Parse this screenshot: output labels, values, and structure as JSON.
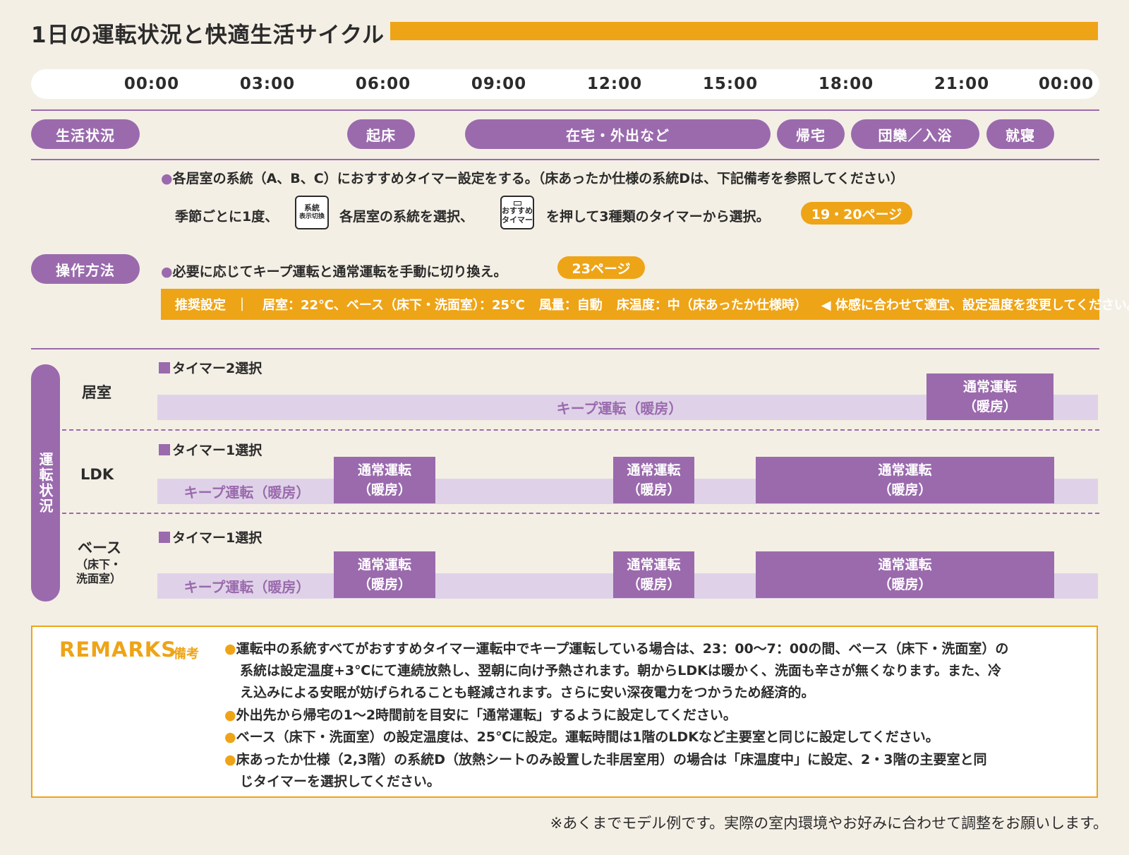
{
  "title": "1日の運転状況と快適生活サイクル",
  "time_axis": [
    "00:00",
    "03:00",
    "06:00",
    "09:00",
    "12:00",
    "15:00",
    "18:00",
    "21:00",
    "00:00"
  ],
  "life": {
    "label": "生活状況",
    "events": [
      "起床",
      "在宅・外出など",
      "帰宅",
      "団欒／入浴",
      "就寝"
    ]
  },
  "operation": {
    "label": "操作方法",
    "line1": "各居室の系統（A、B、C）におすすめタイマー設定をする。（床あったか仕様の系統Dは、下記備考を参照してください）",
    "line2_a": "季節ごとに1度、",
    "button1": [
      "系統",
      "表示切換"
    ],
    "line2_b": "各居室の系統を選択、",
    "button2": [
      "おすすめ",
      "タイマー"
    ],
    "line2_c": "を押して3種類のタイマーから選択。",
    "page1": "19・20ページ",
    "line3": "必要に応じてキープ運転と通常運転を手動に切り換え。",
    "page2": "23ページ",
    "recommend": {
      "label": "推奨設定",
      "sep": "｜",
      "rooms": "居室：22℃、ベース（床下・洗面室）：25℃",
      "wind": "風量：自動",
      "floor": "床温度：中（床あったか仕様時）",
      "note": "◀ 体感に合わせて適宜、設定温度を変更してください。"
    }
  },
  "run_status": {
    "label": "運転状況",
    "rows": [
      {
        "room": "居室",
        "room_sub": "",
        "timer": "タイマー2選択",
        "keep": "キープ運転（暖房）",
        "normal": [
          "通常運転",
          "（暖房）"
        ]
      },
      {
        "room": "LDK",
        "room_sub": "",
        "timer": "タイマー1選択",
        "keep": "キープ運転（暖房）",
        "normal": [
          "通常運転",
          "（暖房）"
        ]
      },
      {
        "room": "ベース",
        "room_sub": "（床下・\n洗面室）",
        "timer": "タイマー1選択",
        "keep": "キープ運転（暖房）",
        "normal": [
          "通常運転",
          "（暖房）"
        ]
      }
    ],
    "room_sub_lines": [
      "（床下・",
      "洗面室）"
    ]
  },
  "remarks": {
    "title": "REMARKS",
    "sub": "備考",
    "lines": [
      "●運転中の系統すべてがおすすめタイマー運転中でキープ運転している場合は、23：00〜7：00の間、ベース（床下・洗面室）の",
      "系統は設定温度+3℃にて連続放熱し、翌朝に向け予熱されます。朝からLDKは暖かく、洗面も辛さが無くなります。また、冷",
      "え込みによる安眠が妨げられることも軽減されます。さらに安い深夜電力をつかうため経済的。",
      "●外出先から帰宅の1〜2時間前を目安に「通常運転」するように設定してください。",
      "●ベース（床下・洗面室）の設定温度は、25℃に設定。運転時間は1階のLDKなど主要室と同じに設定してください。",
      "●床あったか仕様（2,3階）の系統D（放熱シートのみ設置した非居室用）の場合は「床温度中」に設定、2・3階の主要室と同",
      "じタイマーを選択してください。"
    ]
  },
  "footnote": "※あくまでモデル例です。実際の室内環境やお好みに合わせて調整をお願いします。",
  "colors": {
    "purple": "#9a6aad",
    "light_purple": "#dfd2e8",
    "orange": "#eea417",
    "background": "#f4efe5"
  }
}
